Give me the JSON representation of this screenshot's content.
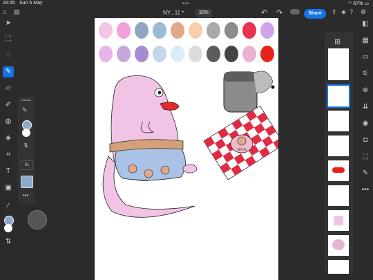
{
  "status_bar": {
    "time": "16:05",
    "date": "Sun 5 May",
    "battery": "67%"
  },
  "document": {
    "name": "NY...11 *",
    "zoom": "30%"
  },
  "top_actions": {
    "share_label": "Share"
  },
  "tool_flyout": {
    "size_value": "91"
  },
  "colors": {
    "accent": "#1473e6",
    "active_color": "#8aa9c9",
    "swatches_row1": [
      "#f3c6e4",
      "#f2a1d8",
      "#8fa6c3",
      "#9bbad8",
      "#e0a98a",
      "#f8cfae",
      "#a9a9a9",
      "#8c8c8c",
      "#e8344c",
      "#cfa4ea"
    ],
    "swatches_row2": [
      "#e8b5ea",
      "#c8a7dc",
      "#a68bd1",
      "#c2d7ec",
      "#d9ecf7",
      "#dcdcdc",
      "#5c5c5c",
      "#444444",
      "#e9b4d4",
      "#e8241a"
    ]
  },
  "artwork": {
    "label_text": "NYLA"
  }
}
